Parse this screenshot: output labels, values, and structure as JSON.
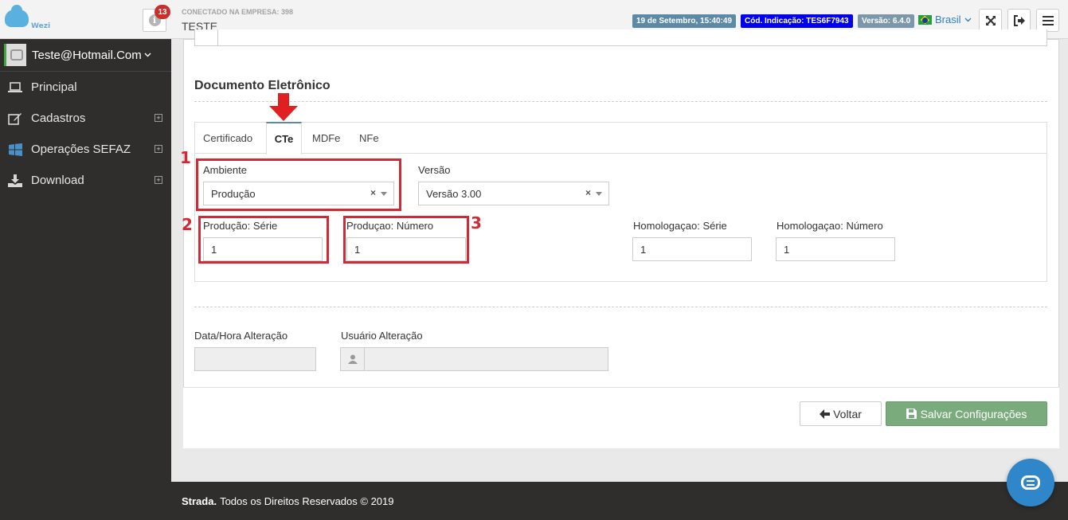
{
  "topbar": {
    "logo_text": "Wezi",
    "notifications_count": "13",
    "connected_label": "CONECTADO NA EMPRESA: 398",
    "company_name": "TESTE",
    "date_badge": "19 de Setembro, 15:40:49",
    "code_badge": "Cód. Indicação: TES6F7943",
    "version_badge": "Versão: 6.4.0",
    "language": "Brasil"
  },
  "sidebar": {
    "user": "Teste@Hotmail.Com",
    "items": [
      {
        "label": "Principal",
        "icon": "laptop-icon"
      },
      {
        "label": "Cadastros",
        "icon": "edit-icon"
      },
      {
        "label": "Operações SEFAZ",
        "icon": "windows-icon"
      },
      {
        "label": "Download",
        "icon": "download-icon"
      }
    ]
  },
  "main": {
    "section_title": "Documento Eletrônico",
    "tabs": [
      "Certificado",
      "CTe",
      "MDFe",
      "NFe"
    ],
    "active_tab": "CTe",
    "ambiente_label": "Ambiente",
    "ambiente_value": "Produção",
    "versao_label": "Versão",
    "versao_value": "Versão 3.00",
    "prod_serie_label": "Produção: Série",
    "prod_serie_value": "1",
    "prod_numero_label": "Produçao: Número",
    "prod_numero_value": "1",
    "hom_serie_label": "Homologaçao: Série",
    "hom_serie_value": "1",
    "hom_numero_label": "Homologaçao: Número",
    "hom_numero_value": "1",
    "data_alteracao_label": "Data/Hora Alteração",
    "usuario_alteracao_label": "Usuário Alteração",
    "annotations": [
      "1",
      "2",
      "3"
    ],
    "back_button": "Voltar",
    "save_button": "Salvar Configurações"
  },
  "footer": {
    "brand": "Strada.",
    "text": "Todos os Direitos Reservados © 2019"
  },
  "colors": {
    "accent_red": "#cf2a35",
    "save_green": "#7aab7c",
    "sidebar_bg": "#2f2e2c",
    "chat_blue": "#2f86c9"
  }
}
